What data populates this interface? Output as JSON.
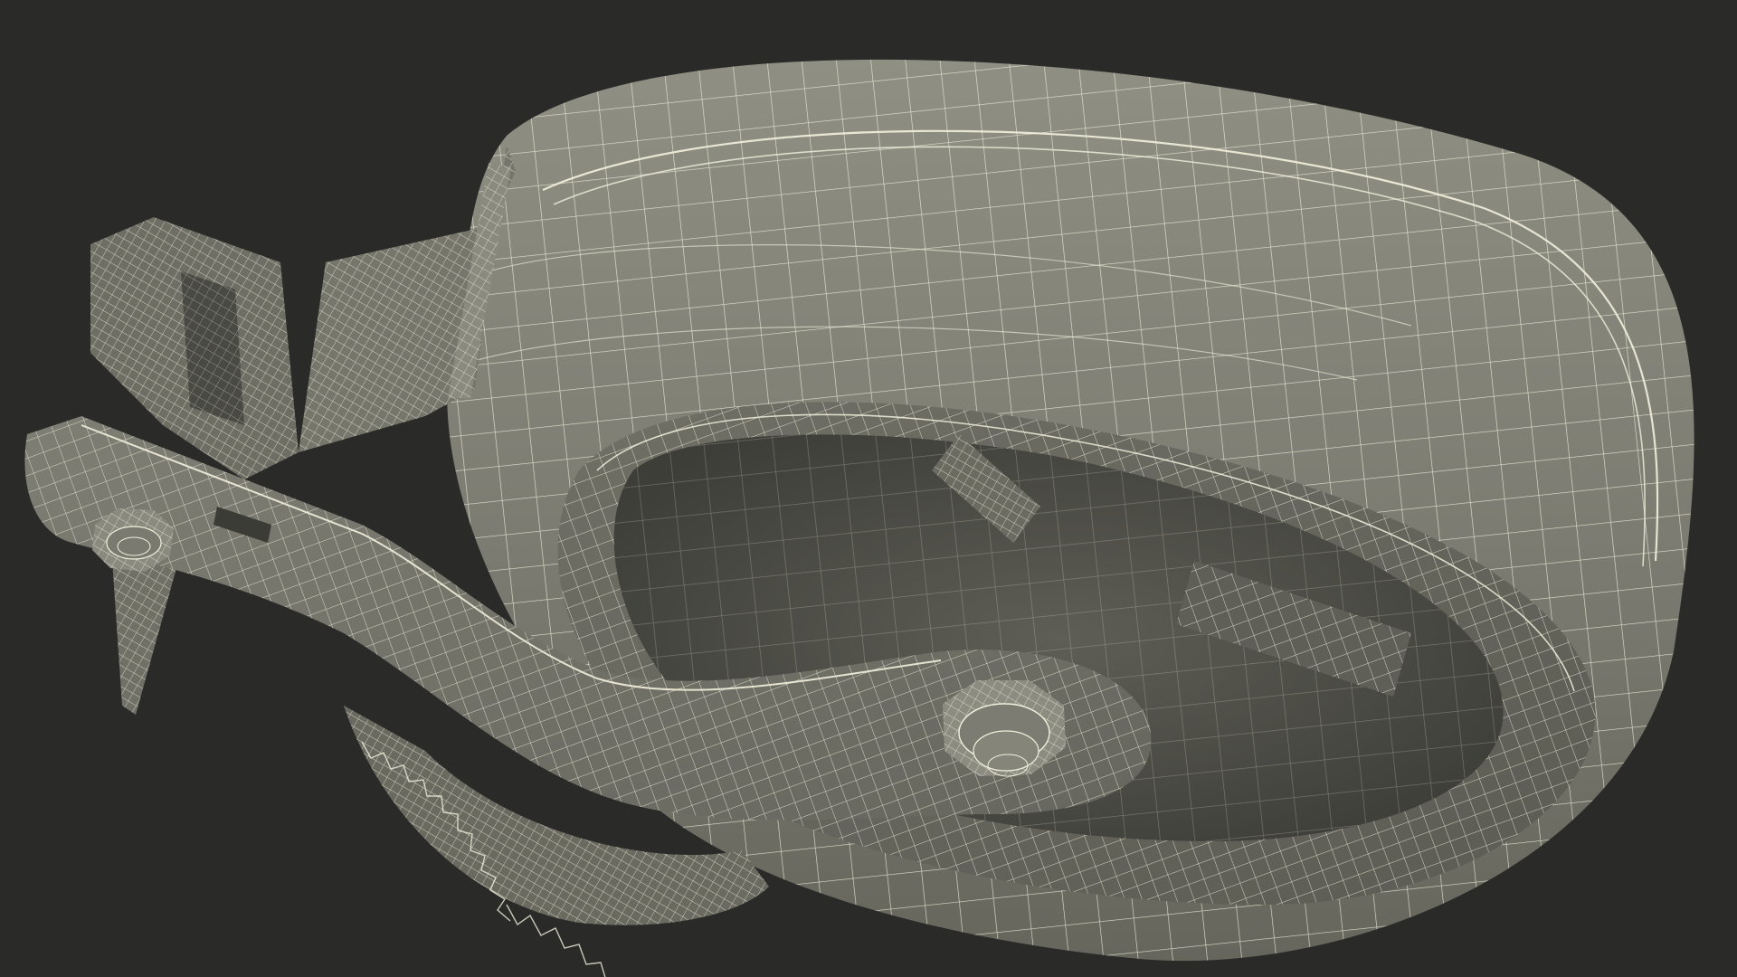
{
  "scene": {
    "subject": "caster-wheel-wireframe",
    "background_color": "#2a2a29",
    "surface_light": "#8e8e82",
    "surface_mid": "#74746a",
    "surface_dark": "#5a5a52",
    "shadow_color": "#3a3a36",
    "wire_color": "#f3f0dc"
  }
}
